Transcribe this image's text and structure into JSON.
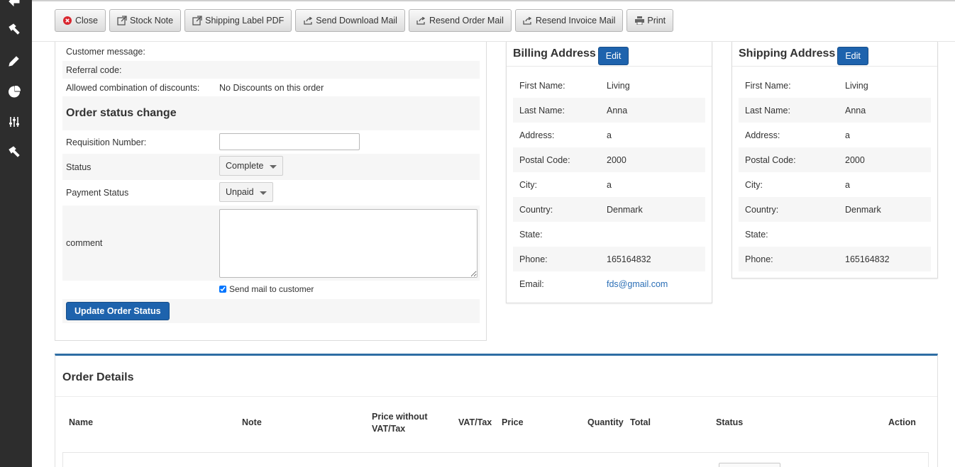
{
  "toolbar": {
    "buttons": [
      {
        "label": "Close",
        "icon": "close-circle-icon"
      },
      {
        "label": "Stock Note",
        "icon": "external-link-icon"
      },
      {
        "label": "Shipping Label PDF",
        "icon": "external-link-icon"
      },
      {
        "label": "Send Download Mail",
        "icon": "share-icon"
      },
      {
        "label": "Resend Order Mail",
        "icon": "share-icon"
      },
      {
        "label": "Resend Invoice Mail",
        "icon": "share-icon"
      },
      {
        "label": "Print",
        "icon": "printer-icon"
      }
    ]
  },
  "sidebar": {
    "icons": [
      "hammer-icon",
      "pencil-icon",
      "pie-chart-icon",
      "sliders-icon",
      "hammer-icon"
    ]
  },
  "order_info": {
    "customer_message_label": "Customer message:",
    "customer_message_value": "",
    "referral_code_label": "Referral code:",
    "referral_code_value": "",
    "discounts_label": "Allowed combination of discounts:",
    "discounts_value": "No Discounts on this order"
  },
  "status_change": {
    "title": "Order status change",
    "requisition_label": "Requisition Number:",
    "requisition_value": "",
    "status_label": "Status",
    "status_value": "Complete",
    "payment_label": "Payment Status",
    "payment_value": "Unpaid",
    "comment_label": "comment",
    "comment_value": "",
    "send_mail_label": "Send mail to customer",
    "send_mail_checked": true,
    "update_button": "Update Order Status"
  },
  "billing": {
    "title": "Billing Address",
    "edit": "Edit",
    "fields": [
      {
        "label": "First Name:",
        "value": "Living"
      },
      {
        "label": "Last Name:",
        "value": "Anna"
      },
      {
        "label": "Address:",
        "value": "a"
      },
      {
        "label": "Postal Code:",
        "value": "2000"
      },
      {
        "label": "City:",
        "value": "a"
      },
      {
        "label": "Country:",
        "value": "Denmark"
      },
      {
        "label": "State:",
        "value": ""
      },
      {
        "label": "Phone:",
        "value": "165164832"
      },
      {
        "label": "Email:",
        "value": "fds@gmail.com"
      }
    ]
  },
  "shipping": {
    "title": "Shipping Address",
    "edit": "Edit",
    "fields": [
      {
        "label": "First Name:",
        "value": "Living"
      },
      {
        "label": "Last Name:",
        "value": "Anna"
      },
      {
        "label": "Address:",
        "value": "a"
      },
      {
        "label": "Postal Code:",
        "value": "2000"
      },
      {
        "label": "City:",
        "value": "a"
      },
      {
        "label": "Country:",
        "value": "Denmark"
      },
      {
        "label": "State:",
        "value": ""
      },
      {
        "label": "Phone:",
        "value": "165164832"
      }
    ]
  },
  "order_details": {
    "title": "Order Details",
    "columns": {
      "name": "Name",
      "note": "Note",
      "price_wo_vat_1": "Price without",
      "price_wo_vat_2": "VAT/Tax",
      "vat": "VAT/Tax",
      "price": "Price",
      "quantity": "Quantity",
      "total": "Total",
      "status": "Status",
      "action": "Action"
    }
  },
  "colors": {
    "primary": "#1e63ad",
    "sidebar": "#2d2d2d",
    "accent_border": "#2e6da4",
    "link": "#2b6fb6"
  }
}
